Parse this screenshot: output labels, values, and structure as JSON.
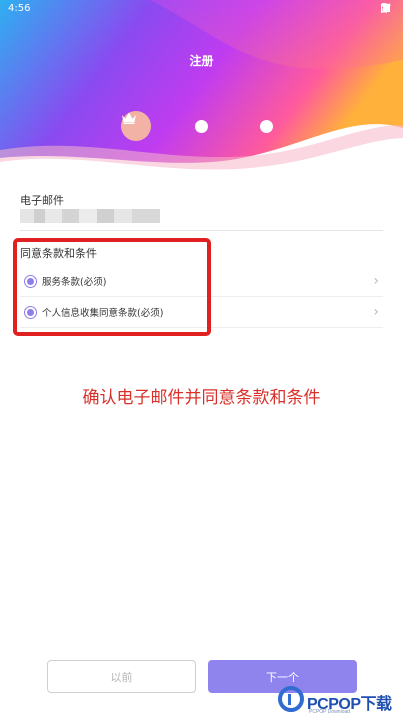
{
  "status_bar": {
    "time": "4:56",
    "wifi_icon": "wifi-icon",
    "signal_icon": "signal-icon",
    "battery_icon": "battery-icon"
  },
  "header": {
    "title": "注册",
    "steps": [
      {
        "icon": "crown-icon",
        "state": "active"
      },
      {
        "icon": "step-dot",
        "state": "inactive"
      },
      {
        "icon": "step-dot",
        "state": "inactive"
      }
    ],
    "gradient_colors": [
      "#2db0f0",
      "#b63cf0",
      "#ff5fa0",
      "#ffb13b"
    ]
  },
  "form": {
    "email_label": "电子邮件",
    "terms_label": "同意条款和条件",
    "terms": [
      {
        "label": "服务条款(必须)",
        "checked": true
      },
      {
        "label": "个人信息收集同意条款(必须)",
        "checked": true
      }
    ]
  },
  "annotation": "确认电子邮件并同意条款和条件",
  "buttons": {
    "prev": "以前",
    "next": "下一个"
  },
  "watermark": {
    "brand": "PCPOP下载",
    "sub": "PCPOP Download"
  },
  "colors": {
    "accent": "#8f84ee",
    "highlight": "#e0211f",
    "annotation": "#d9302a"
  }
}
